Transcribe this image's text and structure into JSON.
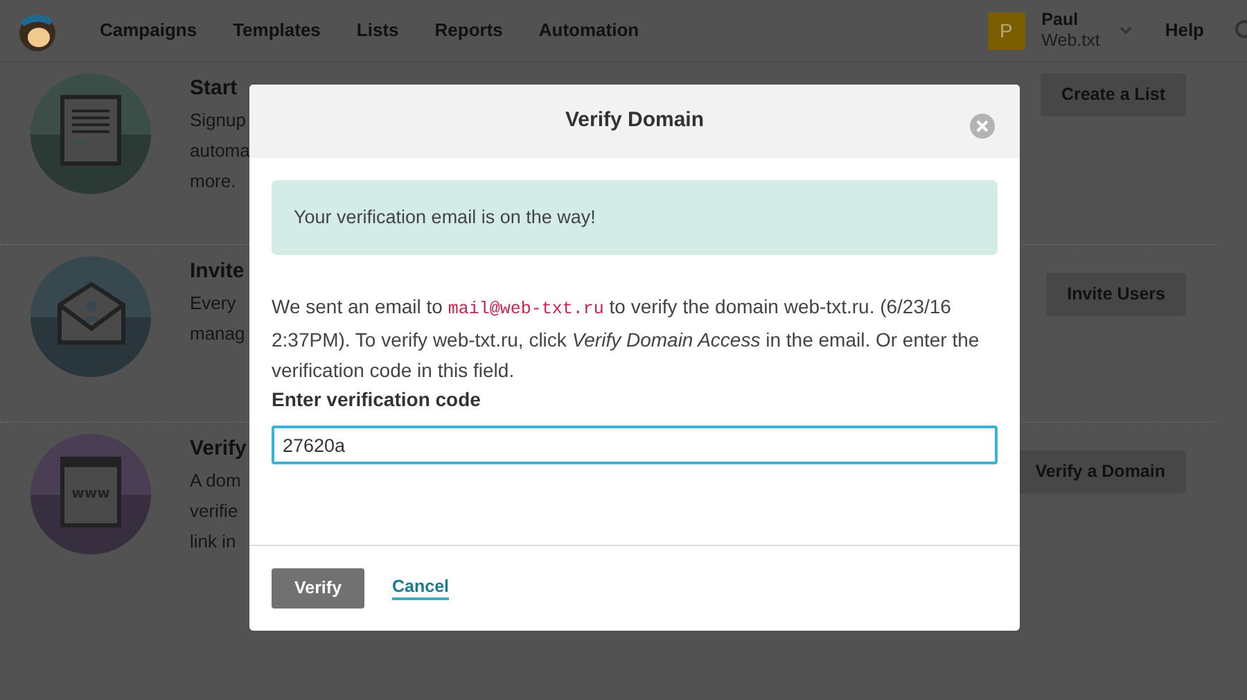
{
  "navbar": {
    "links": [
      "Campaigns",
      "Templates",
      "Lists",
      "Reports",
      "Automation"
    ],
    "account": {
      "initial": "P",
      "name": "Paul",
      "org": "Web.txt"
    },
    "help": "Help"
  },
  "background_rows": [
    {
      "kind": "document",
      "color": "#3b4e48",
      "title": "Start",
      "lines": [
        "Signup",
        "automa",
        "more."
      ],
      "button": "Create a List"
    },
    {
      "kind": "envelope",
      "color": "#37494f",
      "title": "Invite",
      "lines": [
        "Every",
        "manag"
      ],
      "button": "Invite Users"
    },
    {
      "kind": "browser",
      "color": "#4a3e55",
      "icon_label": "www",
      "title": "Verify",
      "lines": [
        "A dom",
        "verifie",
        "link in"
      ],
      "button": "Verify a Domain"
    }
  ],
  "modal": {
    "title": "Verify Domain",
    "alert": "Your verification email is on the way!",
    "message": [
      {
        "kind": "plain",
        "text": "We sent an email to "
      },
      {
        "kind": "code",
        "text": "mail@web-txt.ru"
      },
      {
        "kind": "plain",
        "text": " to verify the domain web-txt.ru. (6/23/16 2:37PM). To verify web-txt.ru, click *Verify Domain Access* in the email. Or enter the verification code in this field."
      }
    ],
    "field": {
      "label": "Enter verification code",
      "value": "27620a"
    },
    "buttons": [
      {
        "kind": "primary",
        "label": "Verify"
      },
      {
        "kind": "link",
        "label": "Cancel"
      }
    ]
  }
}
